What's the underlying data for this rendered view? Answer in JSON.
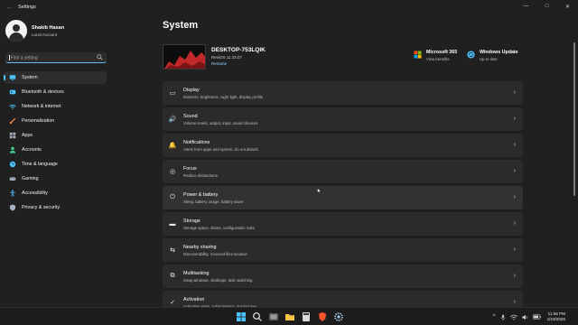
{
  "window": {
    "title": "Settings",
    "back_glyph": "←",
    "minimize_glyph": "—",
    "maximize_glyph": "□",
    "close_glyph": "✕"
  },
  "user": {
    "name": "Shakib Hasan",
    "account": "Local Account"
  },
  "search": {
    "placeholder": "Find a setting"
  },
  "nav": {
    "items": [
      {
        "label": "System",
        "icon": "monitor-icon",
        "color": "#4cc2ff"
      },
      {
        "label": "Bluetooth & devices",
        "icon": "bluetooth-icon",
        "color": "#4cc2ff"
      },
      {
        "label": "Network & internet",
        "icon": "wifi-icon",
        "color": "#4cc2ff"
      },
      {
        "label": "Personalization",
        "icon": "brush-icon",
        "color": "#f7894a"
      },
      {
        "label": "Apps",
        "icon": "apps-icon",
        "color": "#a9b3c4"
      },
      {
        "label": "Accounts",
        "icon": "person-icon",
        "color": "#3ecf8e"
      },
      {
        "label": "Time & language",
        "icon": "clock-globe-icon",
        "color": "#4cc2ff"
      },
      {
        "label": "Gaming",
        "icon": "gamepad-icon",
        "color": "#a9b3c4"
      },
      {
        "label": "Accessibility",
        "icon": "accessibility-icon",
        "color": "#4cc2ff"
      },
      {
        "label": "Privacy & security",
        "icon": "shield-icon",
        "color": "#a9b3c4"
      }
    ],
    "active_index": 0
  },
  "main": {
    "title": "System",
    "device": {
      "name": "DESKTOP-753LQIK",
      "os": "ReviOS 11 23.07",
      "rename": "Rename"
    },
    "quick_links": [
      {
        "title": "Microsoft 365",
        "sub": "View benefits",
        "icon": "microsoft-logo-icon"
      },
      {
        "title": "Windows Update",
        "sub": "Up to date",
        "icon": "update-icon"
      }
    ],
    "cards": [
      {
        "title": "Display",
        "sub": "Monitors, brightness, night light, display profile",
        "icon": "display-icon",
        "glyph": "▭"
      },
      {
        "title": "Sound",
        "sub": "Volume levels, output, input, sound devices",
        "icon": "speaker-icon",
        "glyph": "🔊"
      },
      {
        "title": "Notifications",
        "sub": "Alerts from apps and system, do not disturb",
        "icon": "bell-icon",
        "glyph": "🔔"
      },
      {
        "title": "Focus",
        "sub": "Reduce distractions",
        "icon": "focus-icon",
        "glyph": "◎"
      },
      {
        "title": "Power & battery",
        "sub": "Sleep, battery usage, battery saver",
        "icon": "power-icon",
        "glyph": "⏻"
      },
      {
        "title": "Storage",
        "sub": "Storage space, drives, configuration rules",
        "icon": "storage-icon",
        "glyph": "▬"
      },
      {
        "title": "Nearby sharing",
        "sub": "Discoverability, received files location",
        "icon": "share-icon",
        "glyph": "⇆"
      },
      {
        "title": "Multitasking",
        "sub": "Snap windows, desktops, task switching",
        "icon": "multitask-icon",
        "glyph": "⧉"
      },
      {
        "title": "Activation",
        "sub": "Activation state, subscriptions, product key",
        "icon": "activation-icon",
        "glyph": "✓"
      }
    ],
    "chevron": "›"
  },
  "taskbar": {
    "time": "11:56 PM",
    "date": "1/23/2025",
    "tray_chevron": "^"
  },
  "colors": {
    "accent": "#4cc2ff",
    "background": "#202020",
    "card": "#2b2b2b"
  }
}
